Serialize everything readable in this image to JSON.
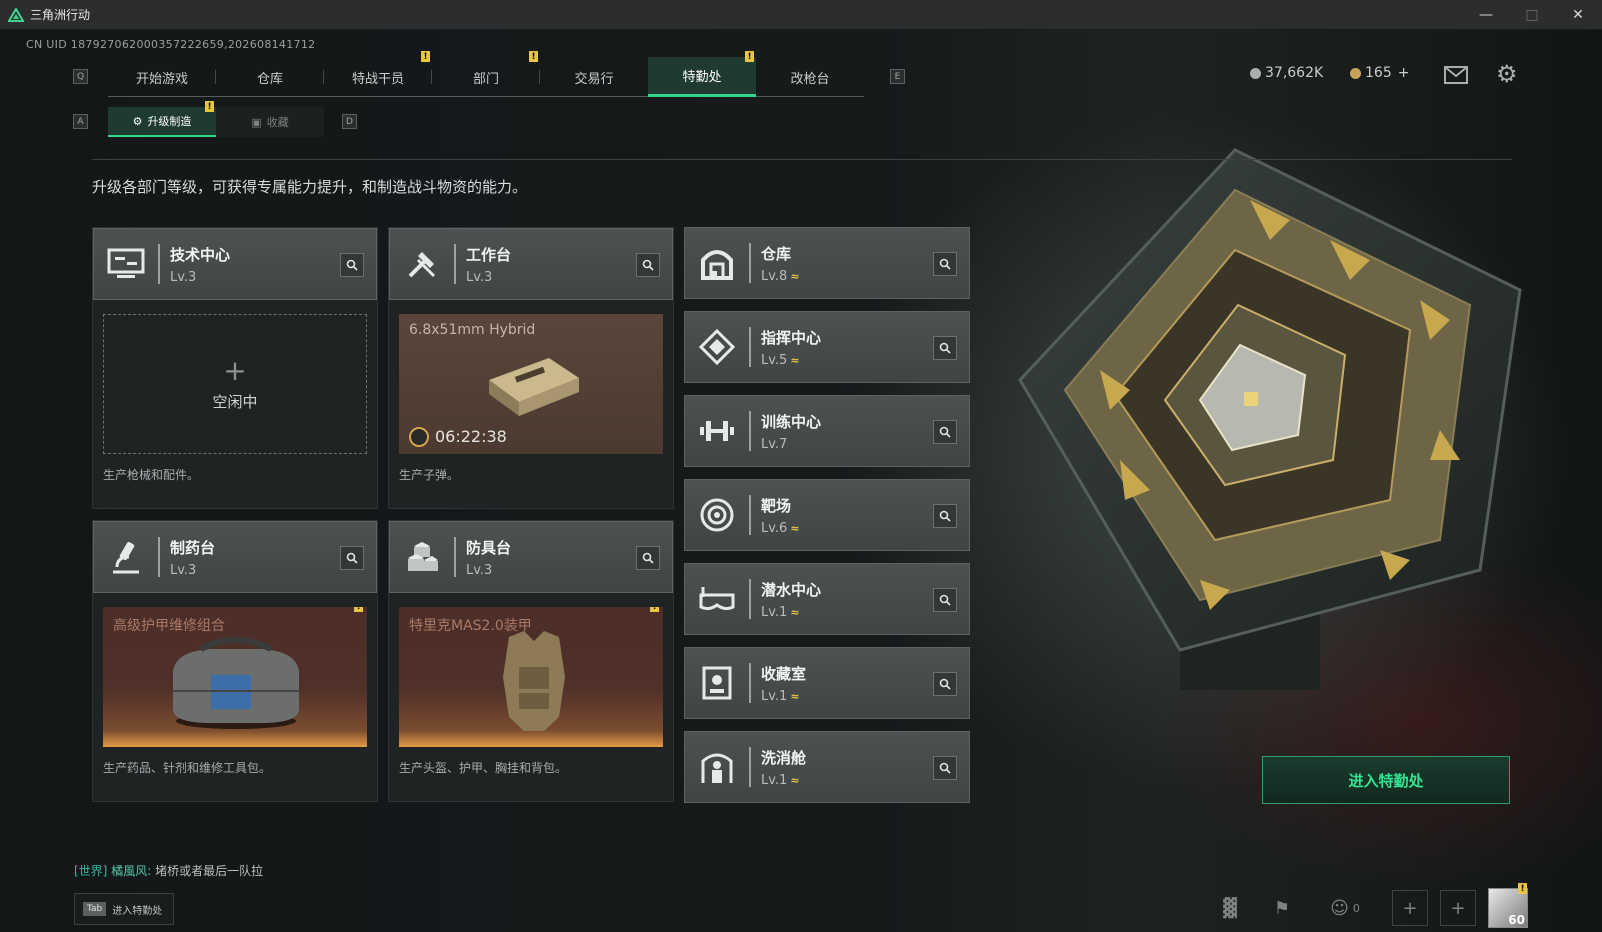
{
  "window": {
    "title": "三角洲行动"
  },
  "uid": "CN UID 1879270620003572226​59,202608141712",
  "nav": {
    "left_key": "Q",
    "right_key": "E",
    "tabs": [
      "开始游戏",
      "仓库",
      "特战干员",
      "部门",
      "交易行",
      "特勤处",
      "改枪台"
    ],
    "active": "特勤处",
    "badge": "!"
  },
  "subnav": {
    "left_key": "A",
    "right_key": "D",
    "tabs": [
      "升级制造",
      "收藏"
    ],
    "active": "升级制造"
  },
  "resources": {
    "coins": "37,662K",
    "gems": "165",
    "plus": "+"
  },
  "description": "升级各部门等级，可获得专属能力提升，和制造战斗物资的能力。",
  "stations": {
    "tech": {
      "name": "技术中心",
      "level": "Lv.3",
      "status": "空闲中",
      "desc": "生产枪械和配件。",
      "plus": "+"
    },
    "workbench": {
      "name": "工作台",
      "level": "Lv.3",
      "item": "6.8x51mm Hybrid",
      "timer": "06:22:38",
      "desc": "生产子弹。"
    },
    "pharma": {
      "name": "制药台",
      "level": "Lv.3",
      "item": "高级护甲维修组合",
      "desc": "生产药品、针剂和维修工具包。"
    },
    "armor": {
      "name": "防具台",
      "level": "Lv.3",
      "item": "特里克MAS2.0装甲",
      "desc": "生产头盔、护甲、胸挂和背包。"
    }
  },
  "facilities": [
    {
      "name": "仓库",
      "level": "Lv.8",
      "upgrade": "≈"
    },
    {
      "name": "指挥中心",
      "level": "Lv.5",
      "upgrade": "≈"
    },
    {
      "name": "训练中心",
      "level": "Lv.7",
      "upgrade": ""
    },
    {
      "name": "靶场",
      "level": "Lv.6",
      "upgrade": "≈"
    },
    {
      "name": "潜水中心",
      "level": "Lv.1",
      "upgrade": "≈"
    },
    {
      "name": "收藏室",
      "level": "Lv.1",
      "upgrade": "≈"
    },
    {
      "name": "洗消舱",
      "level": "Lv.1",
      "upgrade": "≈"
    }
  ],
  "enter_button": "进入特勤处",
  "chat": {
    "channel": "[世界]",
    "user": "橘風风:",
    "message": "堵桥或者最后一队拉"
  },
  "tab_hint": {
    "key": "Tab",
    "label": "进入特勤处"
  },
  "bottom": {
    "friends_count": "0",
    "player_level": "60"
  },
  "colors": {
    "accent": "#33d68b",
    "badge": "#e8c542",
    "panel": "#4c5252"
  }
}
